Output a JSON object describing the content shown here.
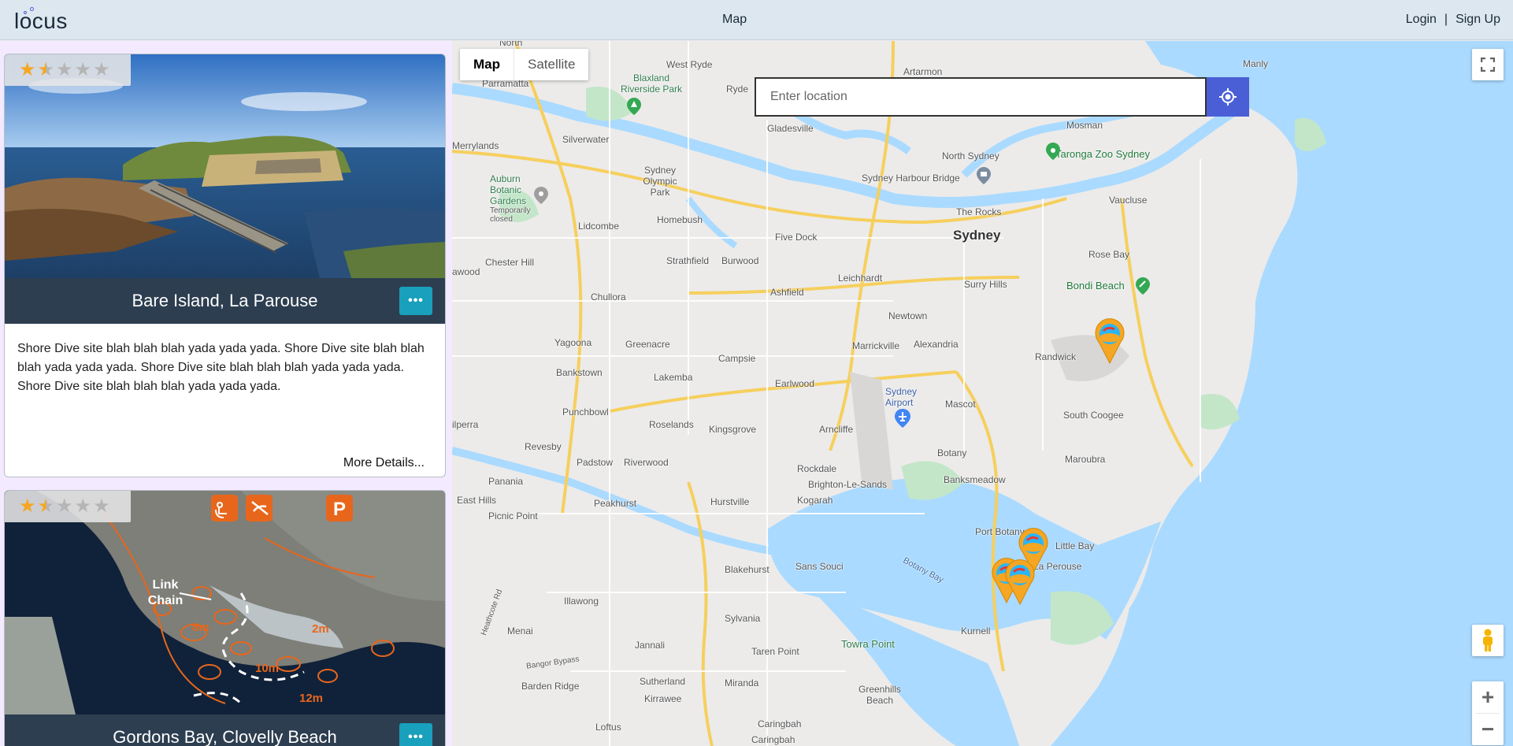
{
  "header": {
    "logo": "locus",
    "center_link": "Map",
    "login": "Login",
    "separator": "|",
    "signup": "Sign Up"
  },
  "sites": [
    {
      "title": "Bare Island, La Parouse",
      "rating": 1.5,
      "max_rating": 5,
      "description": "Shore Dive site blah blah blah yada yada yada. Shore Dive site blah blah blah yada yada yada. Shore Dive site blah blah blah yada yada yada. Shore Dive site blah blah blah yada yada yada.",
      "more_label": "More Details...",
      "menu_label": "•••"
    },
    {
      "title": "Gordons Bay, Clovelly Beach",
      "rating": 1.5,
      "max_rating": 5,
      "menu_label": "•••",
      "image_labels": [
        "Link",
        "Chain",
        "8m",
        "2m",
        "10m",
        "12m"
      ]
    }
  ],
  "map": {
    "type_controls": [
      "Map",
      "Satellite"
    ],
    "active_type": "Map",
    "search": {
      "placeholder": "Enter location"
    },
    "zoom_in": "+",
    "zoom_out": "−",
    "labels": {
      "north": "North",
      "west_ryde": "West Ryde",
      "artarmon": "Artarmon",
      "manly": "Manly",
      "parramatta": "Parramatta",
      "blaxland_park": "Blaxland Riverside Park",
      "ryde": "Ryde",
      "mosman": "Mosman",
      "taronga": "Taronga Zoo Sydney",
      "gladesville": "Gladesville",
      "jerrylands": "Merrylands",
      "silverwater": "Silverwater",
      "north_sydney": "North Sydney",
      "olympic_park": "Sydney Olympic Park",
      "auburn_gardens": "Auburn Botanic Gardens",
      "temp_closed": "Temporarily closed",
      "harbour_bridge": "Sydney Harbour Bridge",
      "vaucluse": "Vaucluse",
      "lidcombe": "Lidcombe",
      "homebush": "Homebush",
      "the_rocks": "The Rocks",
      "five_dock": "Five Dock",
      "sydney": "Sydney",
      "chester_hill": "Chester Hill",
      "strathfield": "Strathfield",
      "burwood": "Burwood",
      "rose_bay": "Rose Bay",
      "guildford": "awood",
      "ashfield": "Ashfield",
      "leichhardt": "Leichhardt",
      "surry_hills": "Surry Hills",
      "bondi": "Bondi Beach",
      "chullora": "Chullora",
      "newtown": "Newtown",
      "yagoona": "Yagoona",
      "greenacre": "Greenacre",
      "marrickville": "Marrickville",
      "alexandria": "Alexandria",
      "randwick": "Randwick",
      "campsie": "Campsie",
      "bankstown": "Bankstown",
      "lakemba": "Lakemba",
      "earlwood": "Earlwood",
      "sydney_airport": "Sydney Airport",
      "mascot": "Mascot",
      "south_coogee": "South Coogee",
      "punchbowl": "Punchbowl",
      "roselands": "Roselands",
      "wilpera": "ilperra",
      "kingsgrove": "Kingsgrove",
      "arncliffe": "Arncliffe",
      "revesby": "Revesby",
      "botany": "Botany",
      "maroubra": "Maroubra",
      "padstow": "Padstow",
      "riverwood": "Riverwood",
      "rockdale": "Rockdale",
      "banksmeadow": "Banksmeadow",
      "panania": "Panania",
      "brighton": "Brighton-Le-Sands",
      "east_hills": "East Hills",
      "peakhurst": "Peakhurst",
      "hurstville": "Hurstville",
      "kogarah": "Kogarah",
      "picnic_point": "Picnic Point",
      "port_botany": "Port Botany",
      "little_bay": "Little Bay",
      "blakehurst": "Blakehurst",
      "sans_souci": "Sans Souci",
      "la_perouse": "La Perouse",
      "botany_bay": "Botany Bay",
      "illawong": "Illawong",
      "heathcote_rd": "Heathcote Rd",
      "kurnell": "Kurnell",
      "sylvania": "Sylvania",
      "menai": "Menai",
      "jannali": "Jannali",
      "towra_point": "Towra Point",
      "taren_point": "Taren Point",
      "bangor_bypass": "Bangor Bypass",
      "barden_ridge": "Barden Ridge",
      "sutherland": "Sutherland",
      "miranda": "Miranda",
      "greenhills": "Greenhills Beach",
      "kirrawee": "Kirrawee",
      "loftus": "Loftus",
      "caringbah": "Caringbah",
      "caringbah2": "Caringbah"
    }
  }
}
